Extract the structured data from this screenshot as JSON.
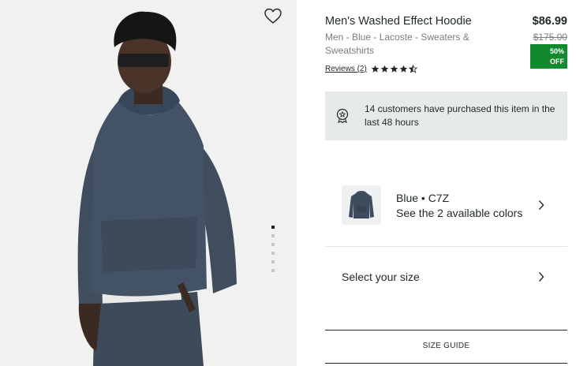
{
  "gallery": {
    "image_alt": "Model wearing washed blue hoodie",
    "slide_count": 6,
    "active_slide": 1
  },
  "product": {
    "title": "Men's Washed Effect Hoodie",
    "breadcrumb": "Men - Blue - Lacoste - Sweaters & Sweatshirts",
    "price": "$86.99",
    "old_price": "$175.00",
    "discount_line1": "50%",
    "discount_line2": "OFF",
    "reviews_label": "Reviews (2)",
    "rating": 4.5,
    "rating_max": 5
  },
  "notice": {
    "text": "14 customers have purchased this item in the last 48 hours",
    "icon": "award-badge-icon"
  },
  "color": {
    "name": "Blue • C7Z",
    "available": "See the 2 available colors"
  },
  "size": {
    "label": "Select your size"
  },
  "size_guide": {
    "label": "SIZE GUIDE"
  },
  "colors": {
    "accent_green": "#118a2e",
    "notice_bg": "#e6ebe7",
    "text_dark": "#1f2a24",
    "text_muted": "#7a7f7c",
    "hoodie": "#3e4d5e"
  }
}
